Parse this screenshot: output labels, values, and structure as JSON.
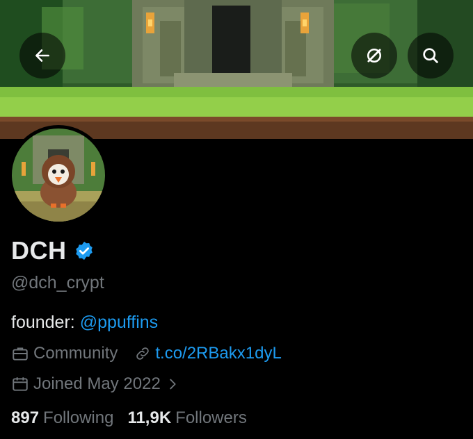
{
  "profile": {
    "name": "DCH",
    "handle": "@dch_crypt",
    "bio_prefix": "founder: ",
    "bio_mention": "@ppuffins",
    "category": "Community",
    "website": "t.co/2RBakx1dyL",
    "joined": "Joined May 2022",
    "following_count": "897",
    "following_label": "Following",
    "followers_count": "11,9K",
    "followers_label": "Followers"
  },
  "icons": {
    "back": "arrow-left-icon",
    "grok": "grok-slash-icon",
    "search": "search-icon",
    "verified": "verified-badge-icon",
    "category": "briefcase-icon",
    "link": "link-icon",
    "calendar": "calendar-icon",
    "chevron": "chevron-right-icon"
  },
  "colors": {
    "accent": "#1d9bf0",
    "muted": "#71767b",
    "text": "#e7e9ea",
    "background": "#000000"
  }
}
